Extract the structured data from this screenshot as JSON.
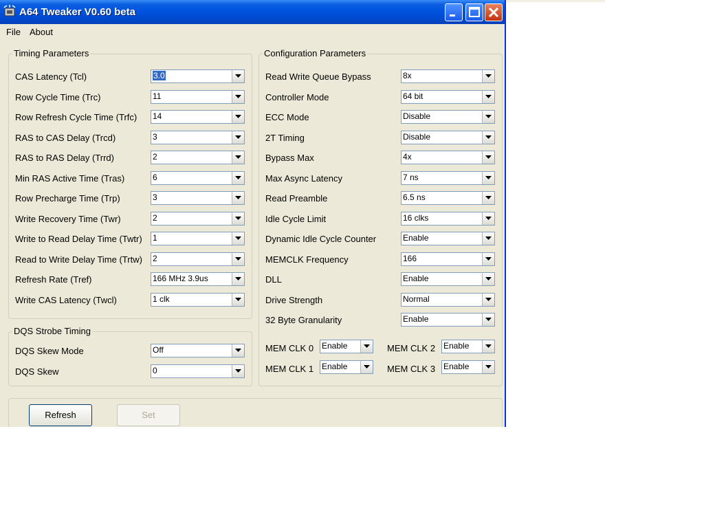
{
  "window": {
    "title": "A64 Tweaker V0.60 beta"
  },
  "menu": {
    "file": "File",
    "about": "About"
  },
  "timing": {
    "title": "Timing Parameters",
    "rows": [
      {
        "label": "CAS Latency (Tcl)",
        "value": "3.0"
      },
      {
        "label": "Row Cycle Time (Trc)",
        "value": "11"
      },
      {
        "label": "Row Refresh Cycle Time (Trfc)",
        "value": "14"
      },
      {
        "label": "RAS to CAS Delay (Trcd)",
        "value": "3"
      },
      {
        "label": "RAS to RAS Delay (Trrd)",
        "value": "2"
      },
      {
        "label": "Min RAS Active Time (Tras)",
        "value": "6"
      },
      {
        "label": "Row Precharge Time (Trp)",
        "value": "3"
      },
      {
        "label": "Write Recovery Time (Twr)",
        "value": "2"
      },
      {
        "label": "Write to Read Delay Time (Twtr)",
        "value": "1"
      },
      {
        "label": "Read to Write Delay Time (Trtw)",
        "value": "2"
      },
      {
        "label": "Refresh Rate (Tref)",
        "value": "166 MHz 3.9us"
      },
      {
        "label": "Write CAS Latency (Twcl)",
        "value": "1 clk"
      }
    ]
  },
  "dqs": {
    "title": "DQS Strobe Timing",
    "rows": [
      {
        "label": "DQS Skew Mode",
        "value": "Off"
      },
      {
        "label": "DQS Skew",
        "value": "0"
      }
    ]
  },
  "config": {
    "title": "Configuration Parameters",
    "rows": [
      {
        "label": "Read Write Queue Bypass",
        "value": "8x"
      },
      {
        "label": "Controller Mode",
        "value": "64 bit"
      },
      {
        "label": "ECC Mode",
        "value": "Disable"
      },
      {
        "label": "2T Timing",
        "value": "Disable"
      },
      {
        "label": "Bypass Max",
        "value": "4x"
      },
      {
        "label": "Max Async Latency",
        "value": "7 ns"
      },
      {
        "label": "Read Preamble",
        "value": "6.5 ns"
      },
      {
        "label": "Idle Cycle Limit",
        "value": "16 clks"
      },
      {
        "label": "Dynamic Idle Cycle Counter",
        "value": "Enable"
      },
      {
        "label": "MEMCLK Frequency",
        "value": "166"
      },
      {
        "label": "DLL",
        "value": "Enable"
      },
      {
        "label": "Drive Strength",
        "value": "Normal"
      },
      {
        "label": "32 Byte Granularity",
        "value": "Enable"
      }
    ],
    "memclk": [
      {
        "label": "MEM CLK 0",
        "value": "Enable"
      },
      {
        "label": "MEM CLK 2",
        "value": "Enable"
      },
      {
        "label": "MEM CLK 1",
        "value": "Enable"
      },
      {
        "label": "MEM CLK 3",
        "value": "Enable"
      }
    ]
  },
  "buttons": {
    "refresh": "Refresh",
    "set": "Set"
  }
}
